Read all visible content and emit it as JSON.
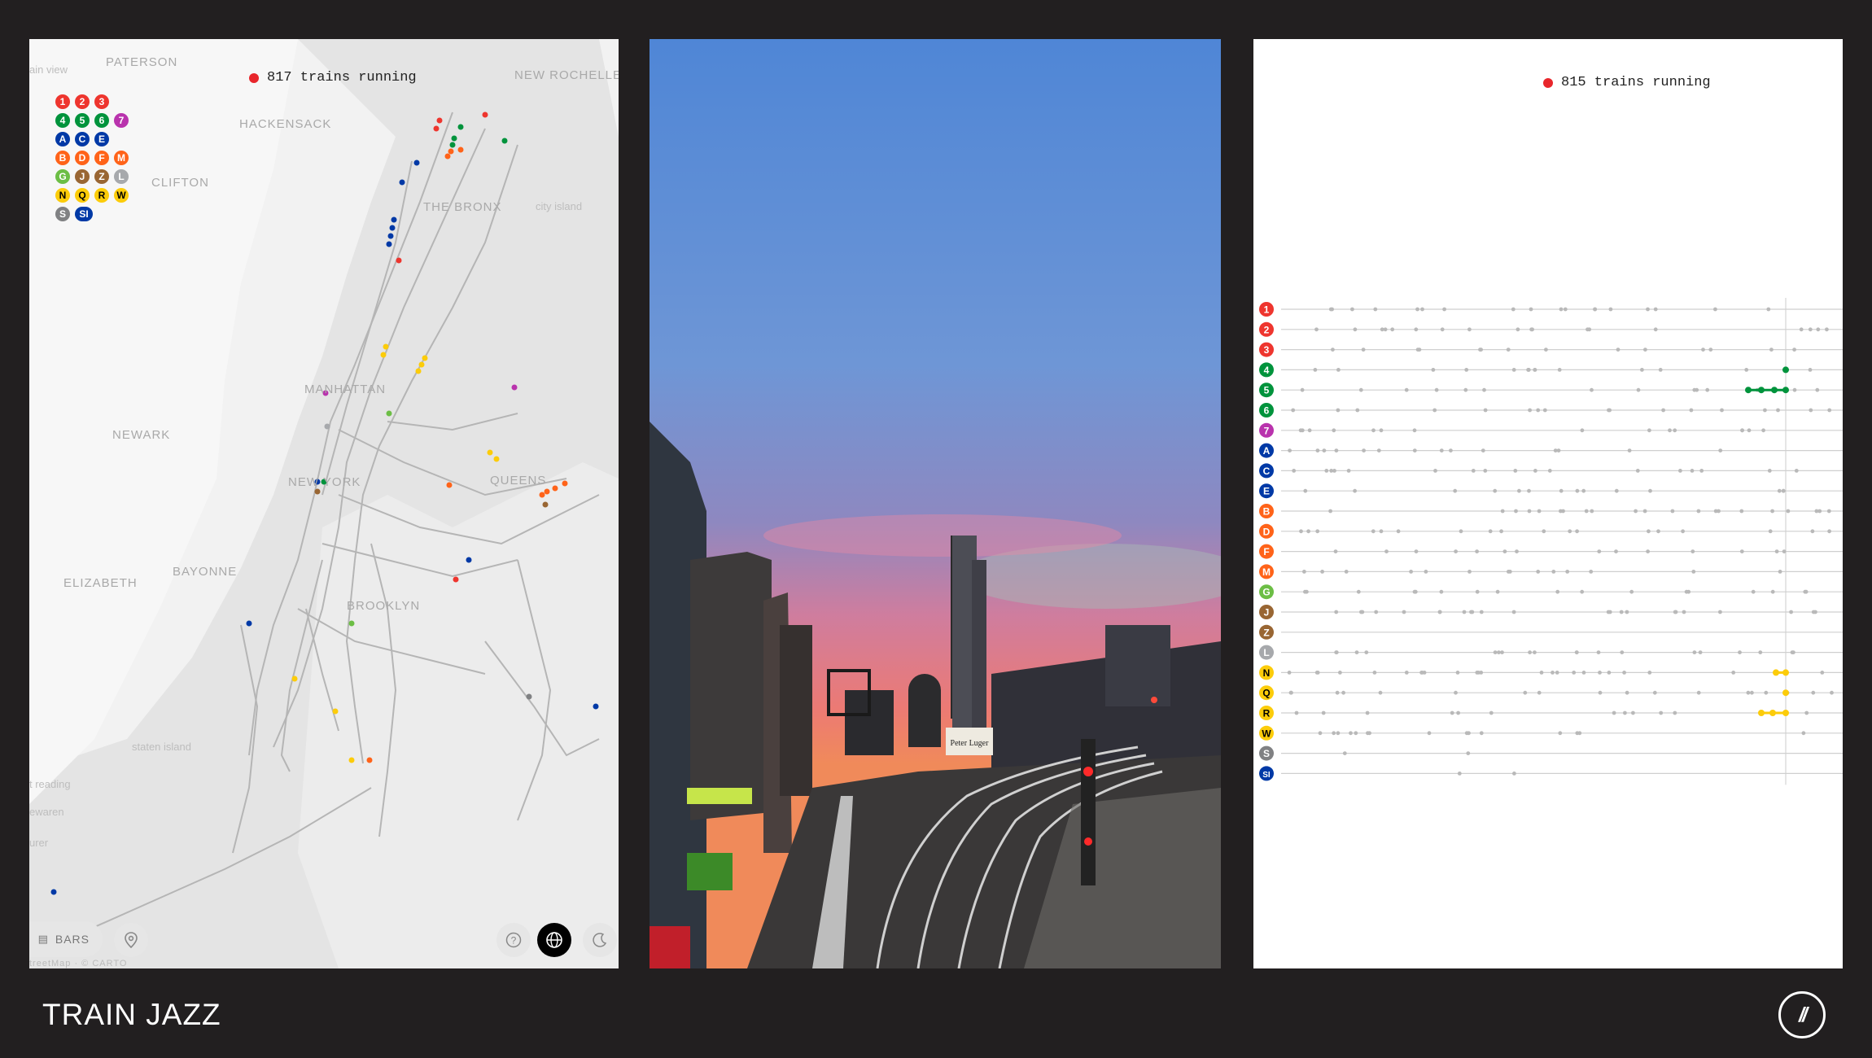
{
  "footer": {
    "title": "TRAIN JAZZ",
    "badge": "//"
  },
  "colors": {
    "red": "#ee352e",
    "green": "#00933c",
    "purple": "#b933ad",
    "blue": "#0039a6",
    "orange": "#ff6319",
    "lime": "#6cbe45",
    "brown": "#996633",
    "gray": "#a7a9ac",
    "yellow": "#fccc0a",
    "shuttle": "#808183",
    "page_bg": "#221f20"
  },
  "map_panel": {
    "trains_running": "817 trains running",
    "labels": [
      "PATERSON",
      "NEW ROCHELLE",
      "HACKENSACK",
      "CLIFTON",
      "THE BRONX",
      "MANHATTAN",
      "NEWARK",
      "NEW YORK",
      "QUEENS",
      "ELIZABETH",
      "BAYONNE",
      "BROOKLYN"
    ],
    "small_labels": [
      "ain view",
      "city island",
      "staten island",
      "t reading",
      "ewaren",
      "urer"
    ],
    "bars_button": "BARS",
    "attribution": "treetMap · © CARTO",
    "controls": [
      "help-icon",
      "globe-icon",
      "moon-icon",
      "location-pin-icon",
      "bars-icon"
    ]
  },
  "photo_panel": {
    "description_icon": "photo",
    "sign_text": "Peter Luger"
  },
  "bars_panel": {
    "trains_running": "815 trains running",
    "lines": [
      {
        "label": "1",
        "color": "#ee352e",
        "text": "#ffffff"
      },
      {
        "label": "2",
        "color": "#ee352e",
        "text": "#ffffff"
      },
      {
        "label": "3",
        "color": "#ee352e",
        "text": "#ffffff"
      },
      {
        "label": "4",
        "color": "#00933c",
        "text": "#ffffff"
      },
      {
        "label": "5",
        "color": "#00933c",
        "text": "#ffffff"
      },
      {
        "label": "6",
        "color": "#00933c",
        "text": "#ffffff"
      },
      {
        "label": "7",
        "color": "#b933ad",
        "text": "#ffffff"
      },
      {
        "label": "A",
        "color": "#0039a6",
        "text": "#ffffff"
      },
      {
        "label": "C",
        "color": "#0039a6",
        "text": "#ffffff"
      },
      {
        "label": "E",
        "color": "#0039a6",
        "text": "#ffffff"
      },
      {
        "label": "B",
        "color": "#ff6319",
        "text": "#ffffff"
      },
      {
        "label": "D",
        "color": "#ff6319",
        "text": "#ffffff"
      },
      {
        "label": "F",
        "color": "#ff6319",
        "text": "#ffffff"
      },
      {
        "label": "M",
        "color": "#ff6319",
        "text": "#ffffff"
      },
      {
        "label": "G",
        "color": "#6cbe45",
        "text": "#ffffff"
      },
      {
        "label": "J",
        "color": "#996633",
        "text": "#ffffff"
      },
      {
        "label": "Z",
        "color": "#996633",
        "text": "#ffffff"
      },
      {
        "label": "L",
        "color": "#a7a9ac",
        "text": "#ffffff"
      },
      {
        "label": "N",
        "color": "#fccc0a",
        "text": "#000000"
      },
      {
        "label": "Q",
        "color": "#fccc0a",
        "text": "#000000"
      },
      {
        "label": "R",
        "color": "#fccc0a",
        "text": "#000000"
      },
      {
        "label": "W",
        "color": "#fccc0a",
        "text": "#000000"
      },
      {
        "label": "S",
        "color": "#808183",
        "text": "#ffffff"
      },
      {
        "label": "SI",
        "color": "#0039a6",
        "text": "#ffffff"
      }
    ]
  }
}
